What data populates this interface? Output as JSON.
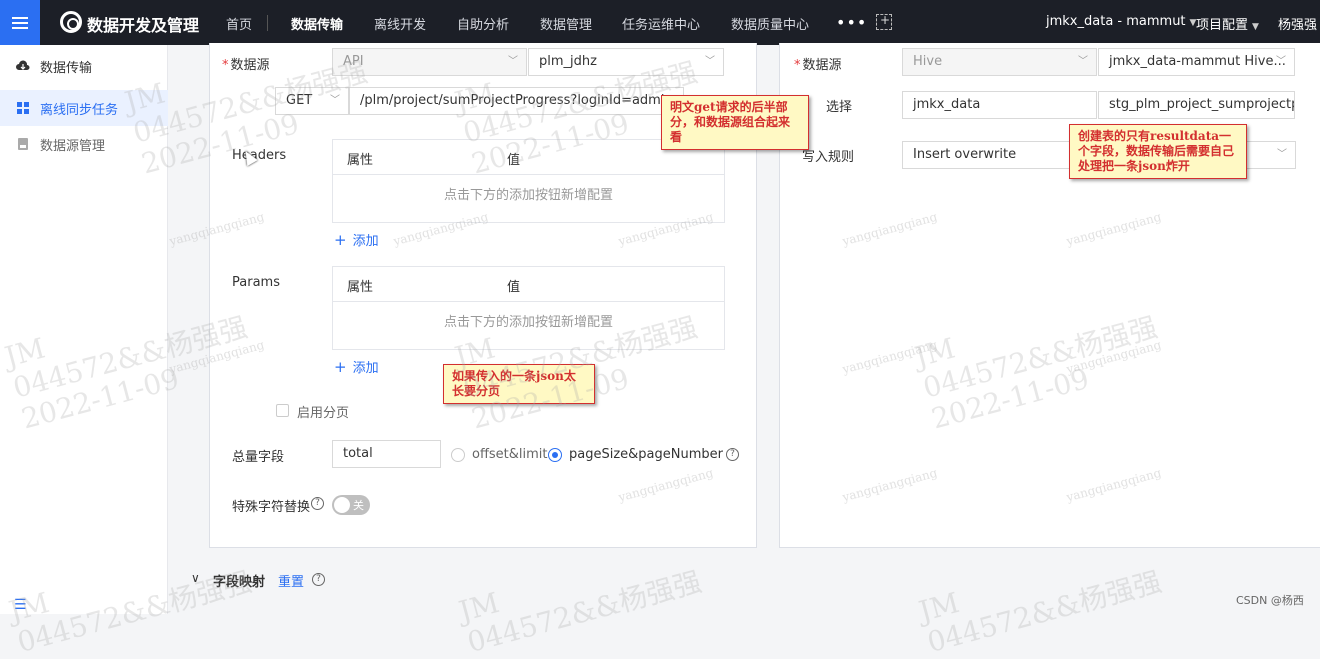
{
  "app": {
    "title": "数据开发及管理"
  },
  "nav": {
    "items": [
      "首页",
      "数据传输",
      "离线开发",
      "自助分析",
      "数据管理",
      "任务运维中心",
      "数据质量中心"
    ],
    "active": "数据传输"
  },
  "topright": {
    "workspace": "jmkx_data - mammut",
    "project_config": "项目配置",
    "user": "杨强强"
  },
  "sidebar": {
    "header": "数据传输",
    "items": [
      {
        "label": "离线同步任务",
        "active": true,
        "icon": "grid-icon"
      },
      {
        "label": "数据源管理",
        "active": false,
        "icon": "database-icon"
      }
    ]
  },
  "source": {
    "datasource_label": "数据源",
    "datasource_type": "API",
    "datasource_name": "plm_jdhz",
    "method": "GET",
    "url": "/plm/project/sumProjectProgress?loginId=admin",
    "headers_label": "Headers",
    "params_label": "Params",
    "col_attr": "属性",
    "col_value": "值",
    "empty_text": "点击下方的添加按钮新增配置",
    "add_label": "添加",
    "paging_label": "启用分页",
    "total_label": "总量字段",
    "total_value": "total",
    "option_offset": "offset&limit",
    "option_page": "pageSize&pageNumber",
    "special_label": "特殊字符替换",
    "toggle_label": "关"
  },
  "target": {
    "datasource_label": "数据源",
    "datasource_type": "Hive",
    "datasource_name": "jmkx_data-mammut Hive...",
    "table_label": "选择",
    "db": "jmkx_data",
    "table": "stg_plm_project_sumprojectpro",
    "write_rule_label": "写入规则",
    "write_rule": "Insert overwrite"
  },
  "notes": {
    "note1": "明文get请求的后半部分，和数据源组合起来看",
    "note2": "创建表的只有resultdata一个字段，数据传输后需要自己处理把一条json炸开",
    "note3": "如果传入的一条json太长要分页"
  },
  "watermark": {
    "line1": "JM",
    "line2": "044572&&杨强强",
    "line3": "2022-11-09",
    "small": "yangqiangqiang"
  },
  "bottom": {
    "section": "字段映射",
    "reset": "重置"
  },
  "footer": {
    "csdn": "CSDN @杨西"
  }
}
